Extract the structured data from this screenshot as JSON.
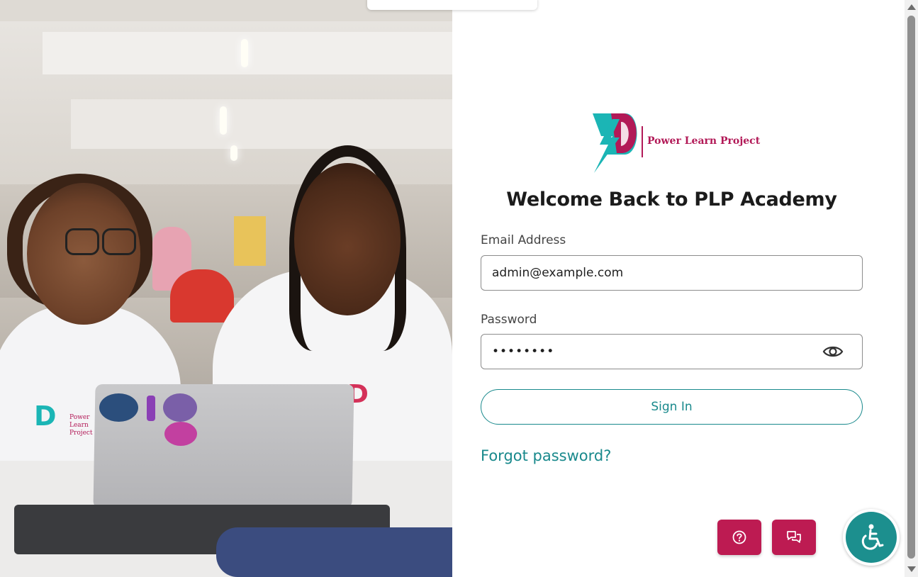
{
  "brand": {
    "name": "Power Learn Project",
    "colors": {
      "primary": "#19898c",
      "accent": "#bd1b52",
      "logo_teal": "#1bb5b5",
      "logo_magenta": "#b21957"
    }
  },
  "hero_image": {
    "shirt_logo_text": [
      "Power",
      "Learn",
      "Project"
    ]
  },
  "login": {
    "title": "Welcome Back to PLP Academy",
    "email": {
      "label": "Email Address",
      "value": "admin@example.com",
      "placeholder": ""
    },
    "password": {
      "label": "Password",
      "value": "••••••••",
      "toggle_icon": "eye-icon"
    },
    "submit_label": "Sign In",
    "forgot_label": "Forgot password?"
  },
  "floating": {
    "help_icon": "question-circle-icon",
    "chat_icon": "chat-bubbles-icon",
    "accessibility_icon": "wheelchair-icon"
  }
}
